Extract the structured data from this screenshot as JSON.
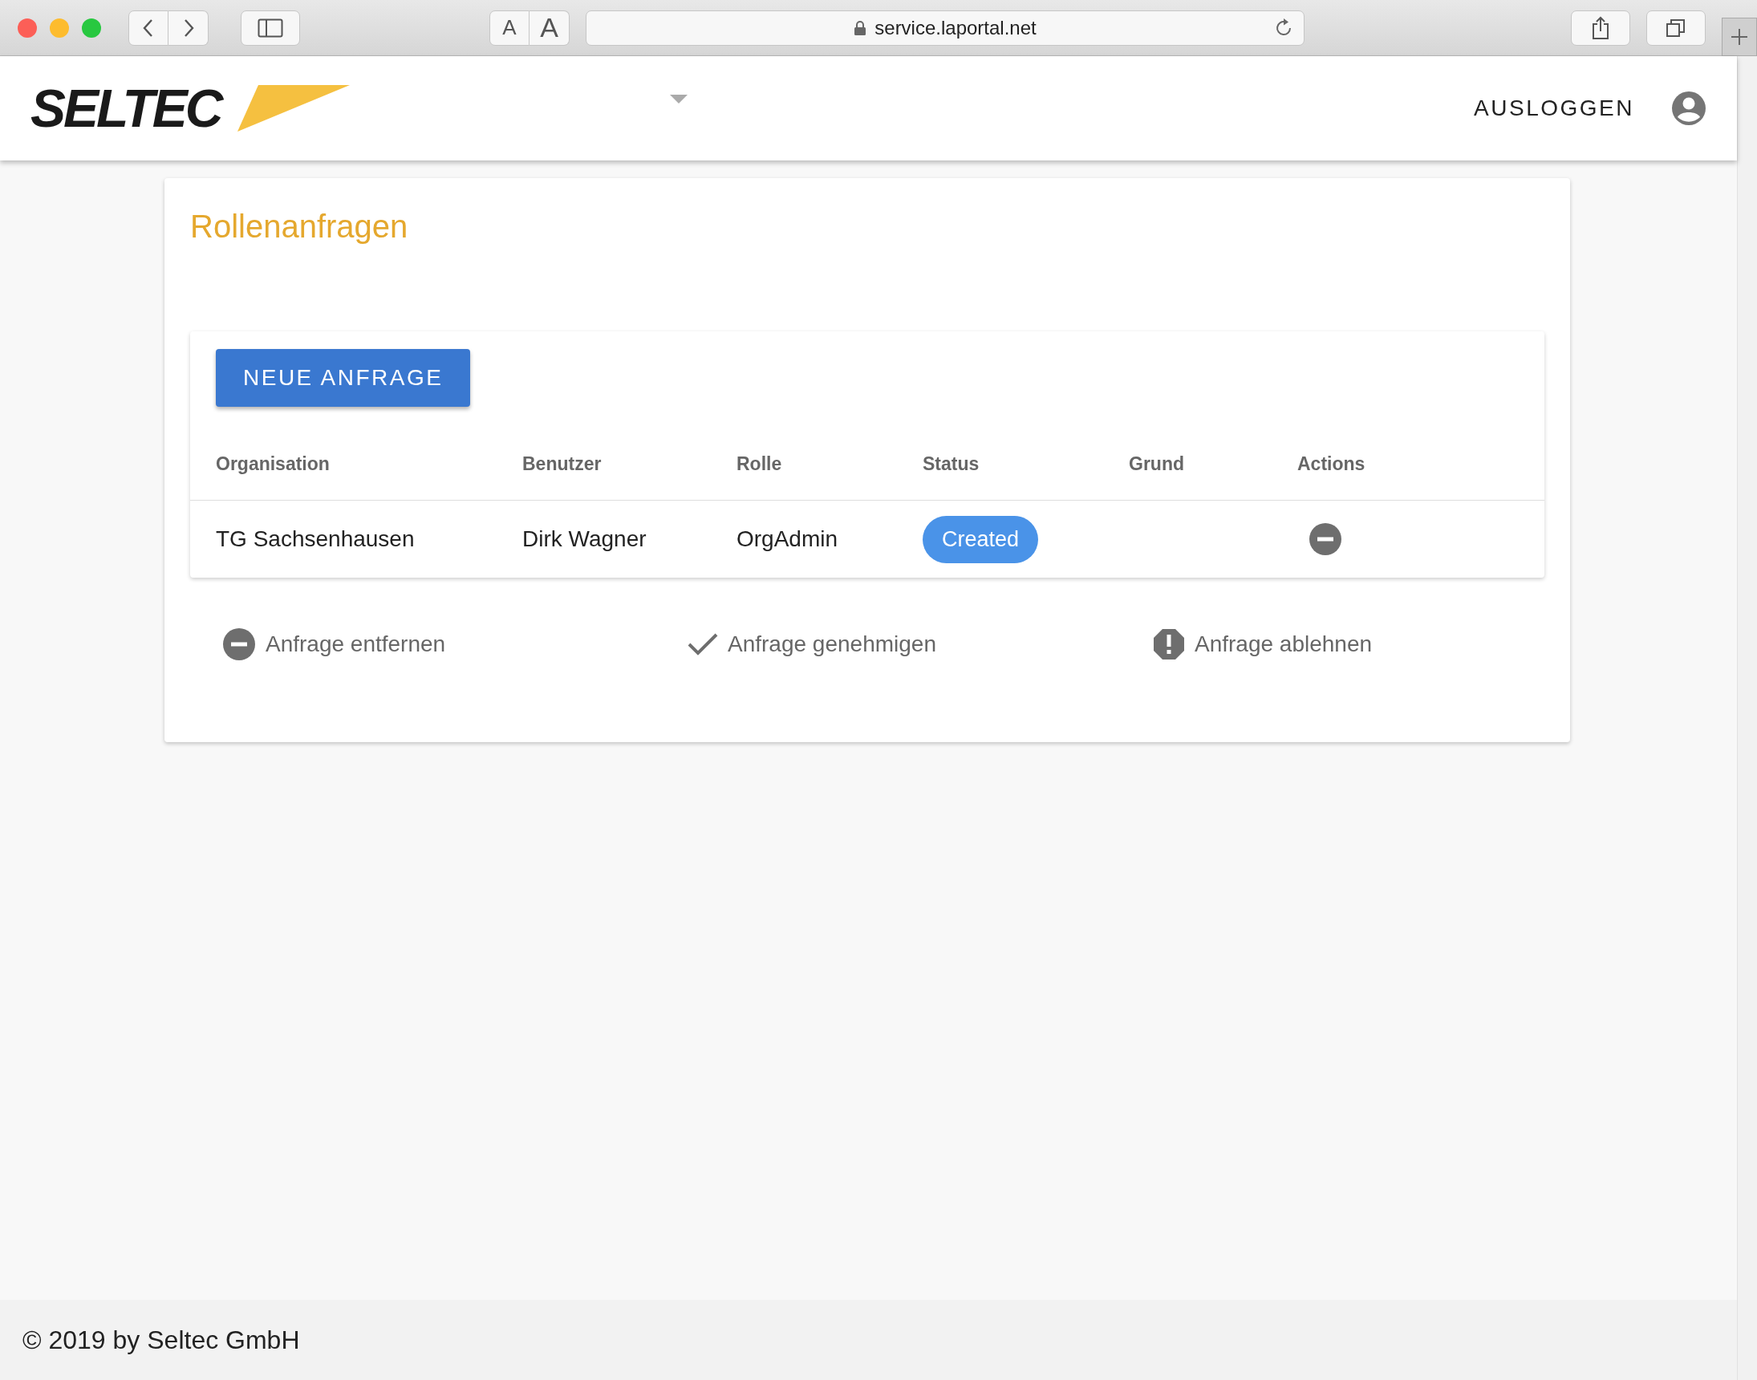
{
  "browser": {
    "text_size_buttons": [
      "A",
      "A"
    ],
    "url": "service.laportal.net"
  },
  "header": {
    "logo": "SELTEC",
    "logout": "AUSLOGGEN"
  },
  "page": {
    "title": "Rollenanfragen",
    "new_button": "NEUE ANFRAGE",
    "columns": [
      "Organisation",
      "Benutzer",
      "Rolle",
      "Status",
      "Grund",
      "Actions"
    ],
    "rows": [
      {
        "organisation": "TG Sachsenhausen",
        "benutzer": "Dirk Wagner",
        "rolle": "OrgAdmin",
        "status": "Created"
      }
    ],
    "legend": [
      {
        "kind": "remove",
        "label": "Anfrage entfernen"
      },
      {
        "kind": "approve",
        "label": "Anfrage genehmigen"
      },
      {
        "kind": "reject",
        "label": "Anfrage ablehnen"
      }
    ]
  },
  "footer": "© 2019 by Seltec GmbH"
}
